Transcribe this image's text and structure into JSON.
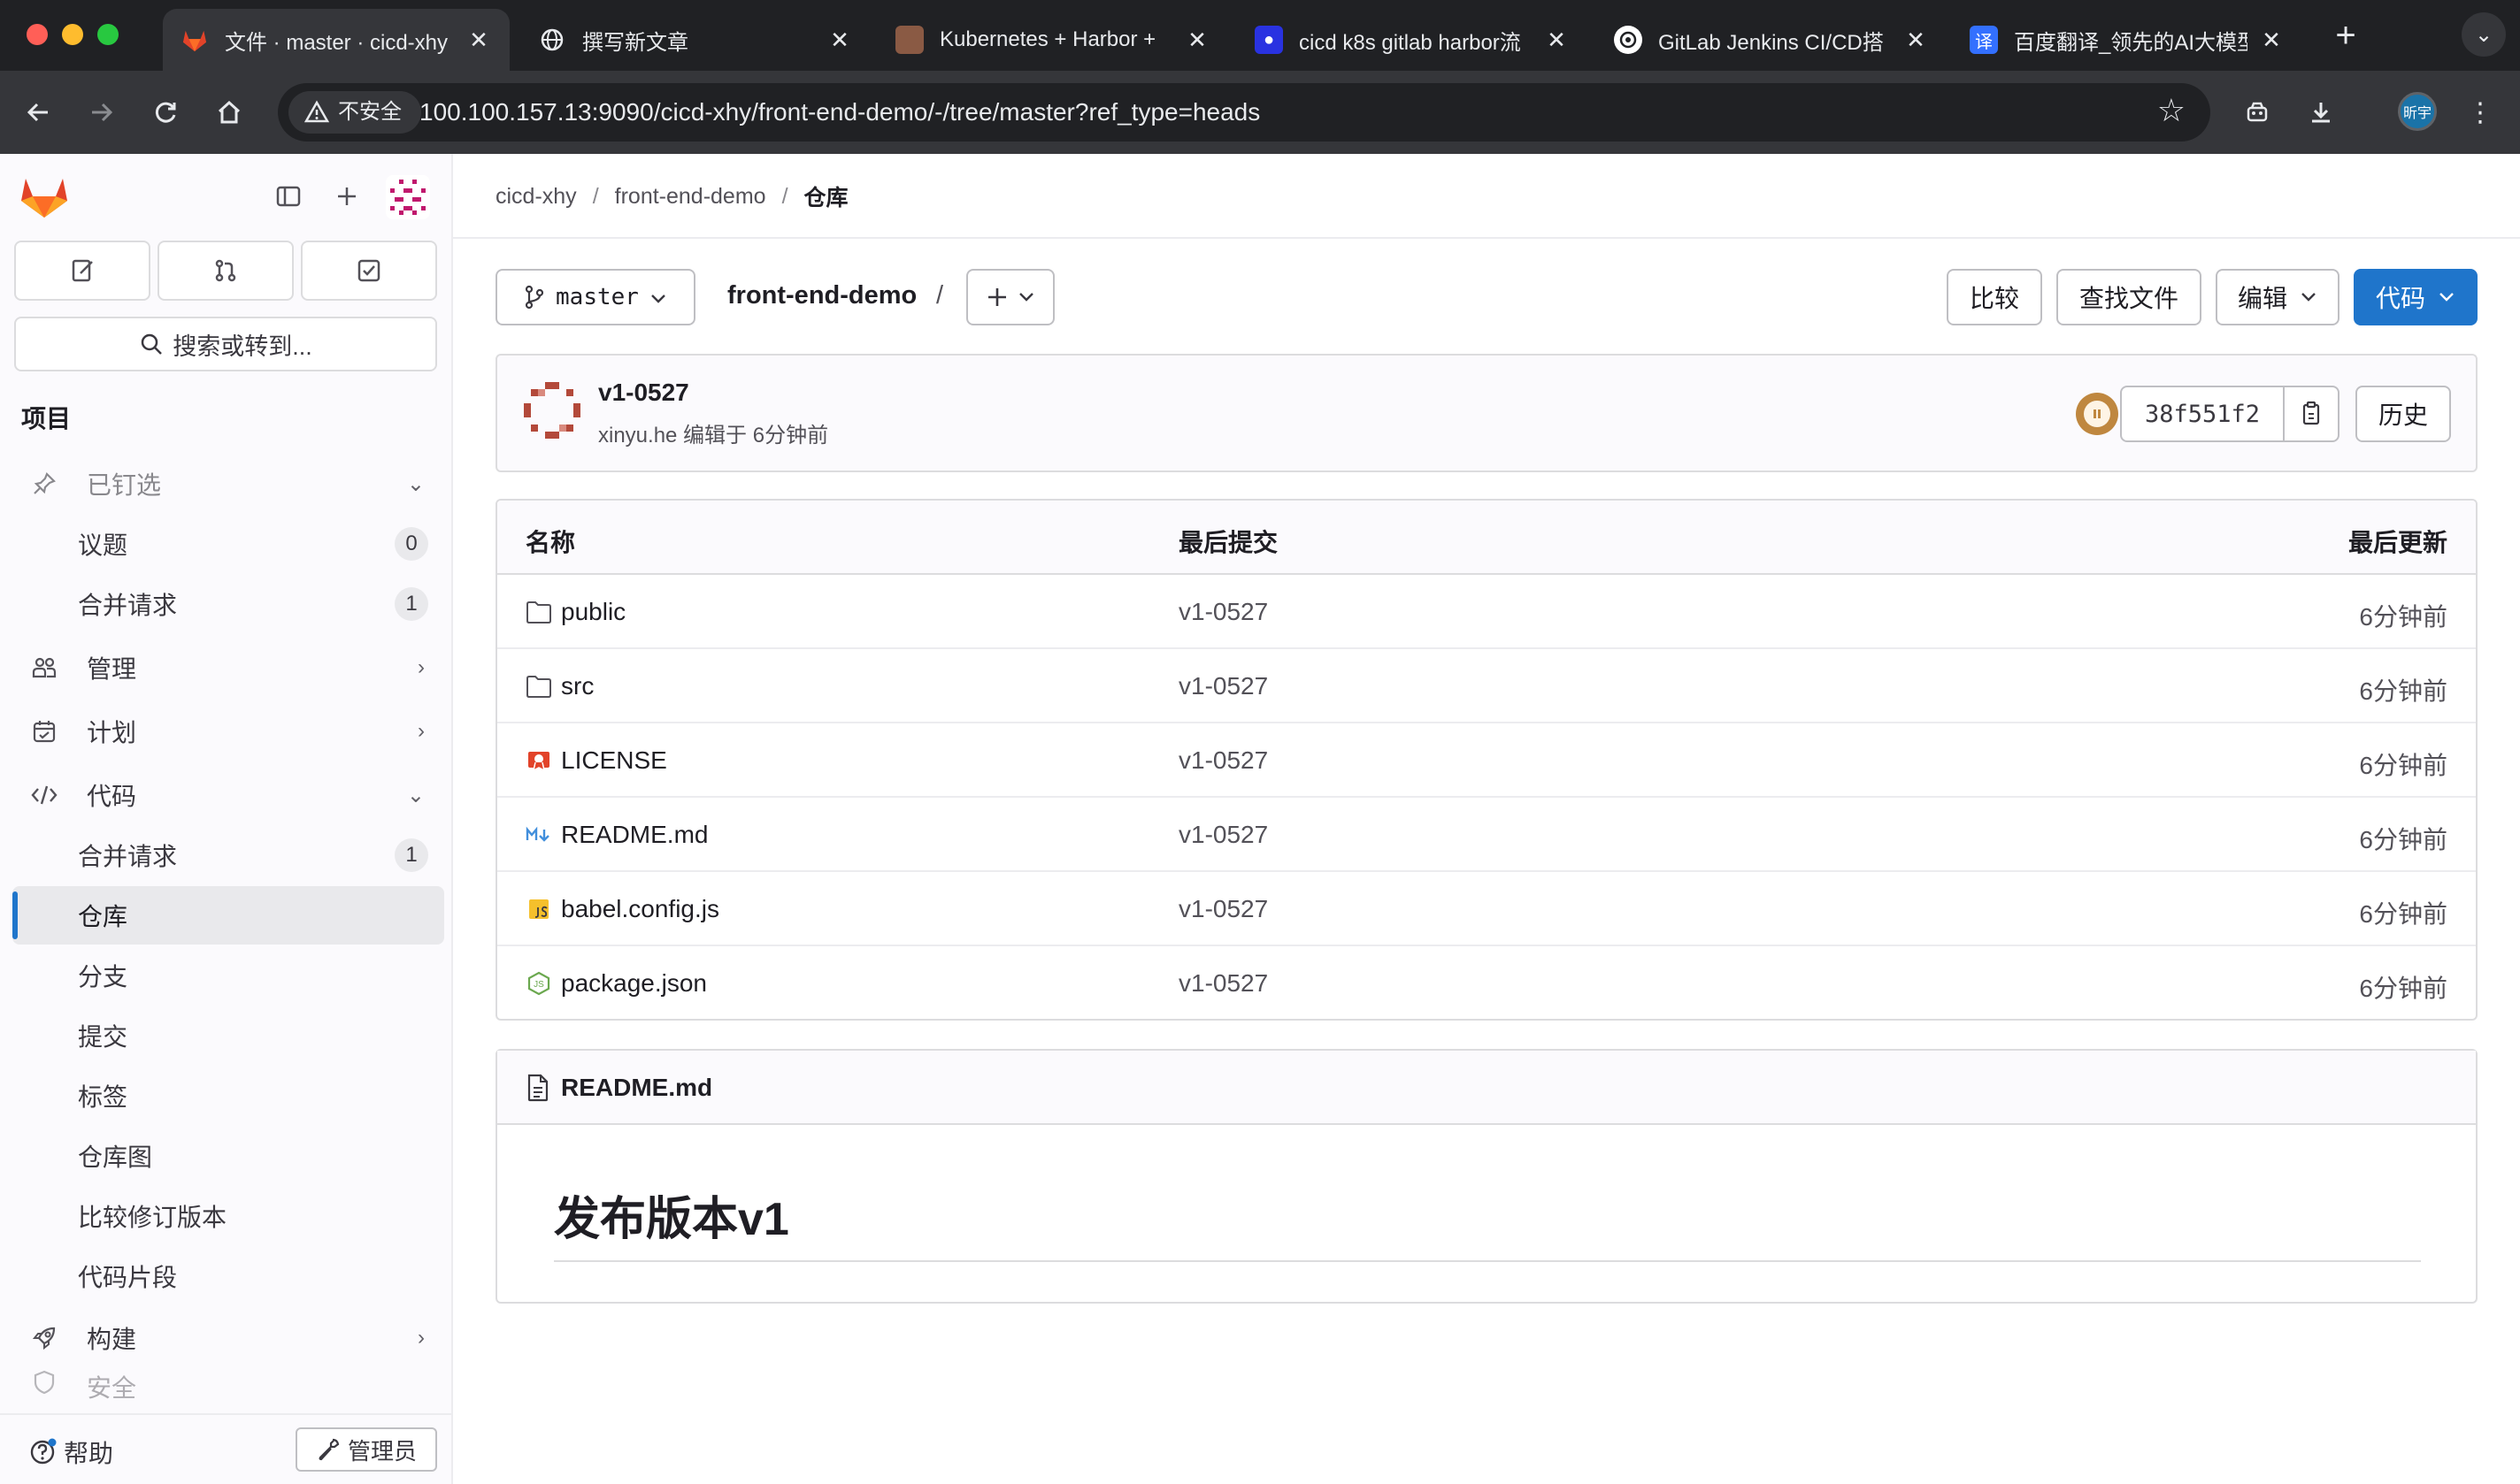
{
  "browser": {
    "tabs": [
      {
        "title": "文件 · master · cicd-xhy"
      },
      {
        "title": "撰写新文章"
      },
      {
        "title": "Kubernetes + Harbor +"
      },
      {
        "title": "cicd k8s gitlab harbor流"
      },
      {
        "title": "GitLab Jenkins CI/CD搭"
      },
      {
        "title": "百度翻译_领先的AI大模型"
      }
    ],
    "insecure_label": "不安全",
    "url": "100.100.157.13:9090/cicd-xhy/front-end-demo/-/tree/master?ref_type=heads",
    "profile_label": "昕宇"
  },
  "sidebar": {
    "search_label": "搜索或转到...",
    "section_title": "项目",
    "pinned_label": "已钉选",
    "pinned_items": [
      {
        "label": "议题",
        "count": "0"
      },
      {
        "label": "合并请求",
        "count": "1"
      }
    ],
    "groups": [
      {
        "label": "管理"
      },
      {
        "label": "计划"
      },
      {
        "label": "代码"
      }
    ],
    "code_items": [
      {
        "label": "合并请求",
        "count": "1"
      },
      {
        "label": "仓库"
      },
      {
        "label": "分支"
      },
      {
        "label": "提交"
      },
      {
        "label": "标签"
      },
      {
        "label": "仓库图"
      },
      {
        "label": "比较修订版本"
      },
      {
        "label": "代码片段"
      }
    ],
    "build_label": "构建",
    "partial_label": "安全",
    "help_label": "帮助",
    "admin_label": "管理员"
  },
  "breadcrumb": {
    "group": "cicd-xhy",
    "project": "front-end-demo",
    "current": "仓库"
  },
  "repo": {
    "branch": "master",
    "path": "front-end-demo",
    "path_sep": "/",
    "compare_label": "比较",
    "find_file_label": "查找文件",
    "edit_label": "编辑",
    "code_label": "代码"
  },
  "commit": {
    "title": "v1-0527",
    "meta": "xinyu.he 编辑于 6分钟前",
    "sha": "38f551f2",
    "history_label": "历史"
  },
  "tree": {
    "headers": {
      "name": "名称",
      "last_commit": "最后提交",
      "last_update": "最后更新"
    },
    "rows": [
      {
        "name": "public",
        "icon": "folder-icon",
        "commit": "v1-0527",
        "time": "6分钟前"
      },
      {
        "name": "src",
        "icon": "folder-icon",
        "commit": "v1-0527",
        "time": "6分钟前"
      },
      {
        "name": "LICENSE",
        "icon": "license-icon",
        "commit": "v1-0527",
        "time": "6分钟前"
      },
      {
        "name": "README.md",
        "icon": "markdown-icon",
        "commit": "v1-0527",
        "time": "6分钟前"
      },
      {
        "name": "babel.config.js",
        "icon": "javascript-icon",
        "commit": "v1-0527",
        "time": "6分钟前"
      },
      {
        "name": "package.json",
        "icon": "nodejs-icon",
        "commit": "v1-0527",
        "time": "6分钟前"
      }
    ]
  },
  "readme": {
    "filename": "README.md",
    "heading": "发布版本v1"
  },
  "colors": {
    "primary": "#1f75cb",
    "chrome_dark": "#202124",
    "gitlab_orange": "#e24329"
  }
}
